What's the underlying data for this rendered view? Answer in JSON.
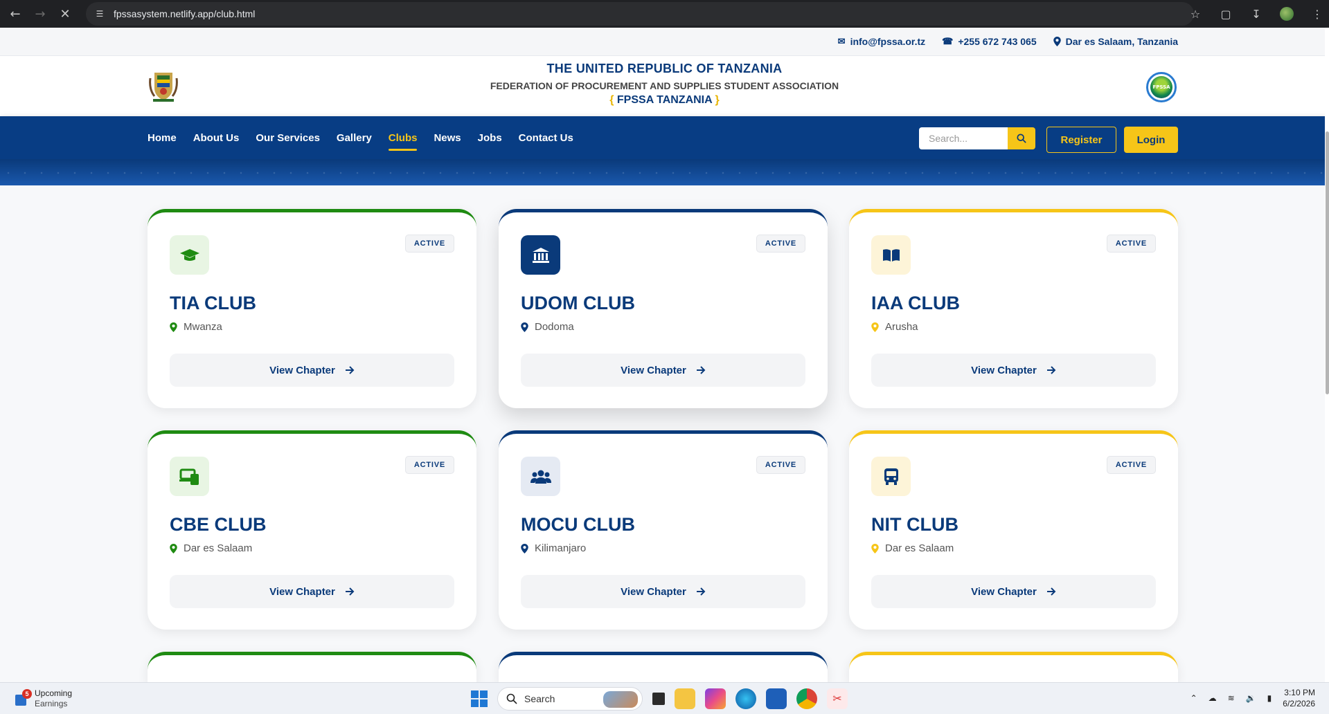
{
  "browser": {
    "url": "fpssasystem.netlify.app/club.html"
  },
  "topbar": {
    "email": "info@fpssa.or.tz",
    "phone": "+255 672 743 065",
    "location": "Dar es Salaam, Tanzania"
  },
  "header": {
    "title": "THE UNITED REPUBLIC OF TANZANIA",
    "subtitle": "FEDERATION OF PROCUREMENT AND SUPPLIES STUDENT ASSOCIATION",
    "brand_open": "{",
    "brand": "FPSSA TANZANIA",
    "brand_close": "}",
    "badge_text": "FPSSA"
  },
  "nav": {
    "items": [
      "Home",
      "About Us",
      "Our Services",
      "Gallery",
      "Clubs",
      "News",
      "Jobs",
      "Contact Us"
    ],
    "active": "Clubs",
    "search_placeholder": "Search...",
    "register": "Register",
    "login": "Login"
  },
  "clubs": [
    {
      "name": "TIA CLUB",
      "location": "Mwanza",
      "status": "ACTIVE",
      "accent": "green",
      "icon": "graduation-cap-icon",
      "button": "View Chapter"
    },
    {
      "name": "UDOM CLUB",
      "location": "Dodoma",
      "status": "ACTIVE",
      "accent": "blue",
      "icon": "university-icon",
      "button": "View Chapter"
    },
    {
      "name": "IAA CLUB",
      "location": "Arusha",
      "status": "ACTIVE",
      "accent": "gold",
      "icon": "book-icon",
      "button": "View Chapter"
    },
    {
      "name": "CBE CLUB",
      "location": "Dar es Salaam",
      "status": "ACTIVE",
      "accent": "green",
      "icon": "devices-icon",
      "button": "View Chapter"
    },
    {
      "name": "MOCU CLUB",
      "location": "Kilimanjaro",
      "status": "ACTIVE",
      "accent": "blue",
      "icon": "users-icon",
      "button": "View Chapter"
    },
    {
      "name": "NIT CLUB",
      "location": "Dar es Salaam",
      "status": "ACTIVE",
      "accent": "gold",
      "icon": "bus-icon",
      "button": "View Chapter"
    }
  ],
  "colors": {
    "primary": "#0a3a7a",
    "gold": "#f6c518",
    "green": "#1f8b12"
  },
  "taskbar": {
    "widget_title": "Upcoming",
    "widget_sub": "Earnings",
    "widget_badge": "5",
    "search": "Search",
    "time": "3:10 PM",
    "date": "6/2/2026"
  }
}
